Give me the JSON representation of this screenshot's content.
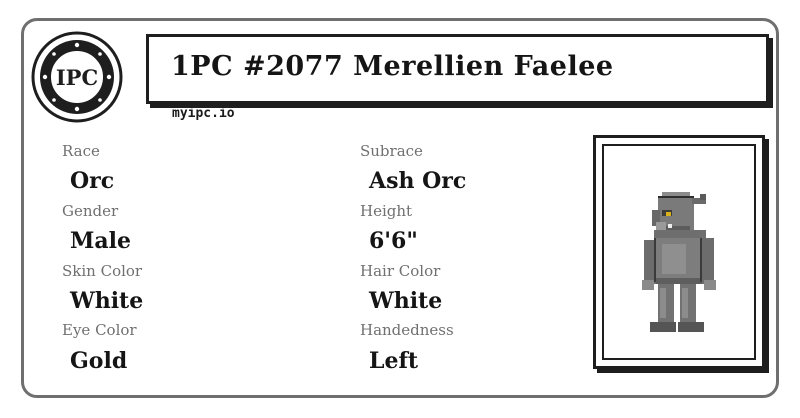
{
  "seal": {
    "text": "IPC",
    "icon": "ipc-seal-logo"
  },
  "header": {
    "title": "1PC #2077 Merellien Faelee",
    "site": "myipc.io"
  },
  "fields": {
    "race": {
      "label": "Race",
      "value": "Orc"
    },
    "subrace": {
      "label": "Subrace",
      "value": "Ash Orc"
    },
    "gender": {
      "label": "Gender",
      "value": "Male"
    },
    "height": {
      "label": "Height",
      "value": "6'6\""
    },
    "skin_color": {
      "label": "Skin Color",
      "value": "White"
    },
    "hair_color": {
      "label": "Hair Color",
      "value": "White"
    },
    "eye_color": {
      "label": "Eye Color",
      "value": "Gold"
    },
    "handedness": {
      "label": "Handedness",
      "value": "Left"
    }
  },
  "portrait": {
    "icon": "orc-character-sprite"
  },
  "colors": {
    "border": "#6f6f6f",
    "ink": "#151515",
    "label": "#707070",
    "eye": "#d9b21a"
  }
}
